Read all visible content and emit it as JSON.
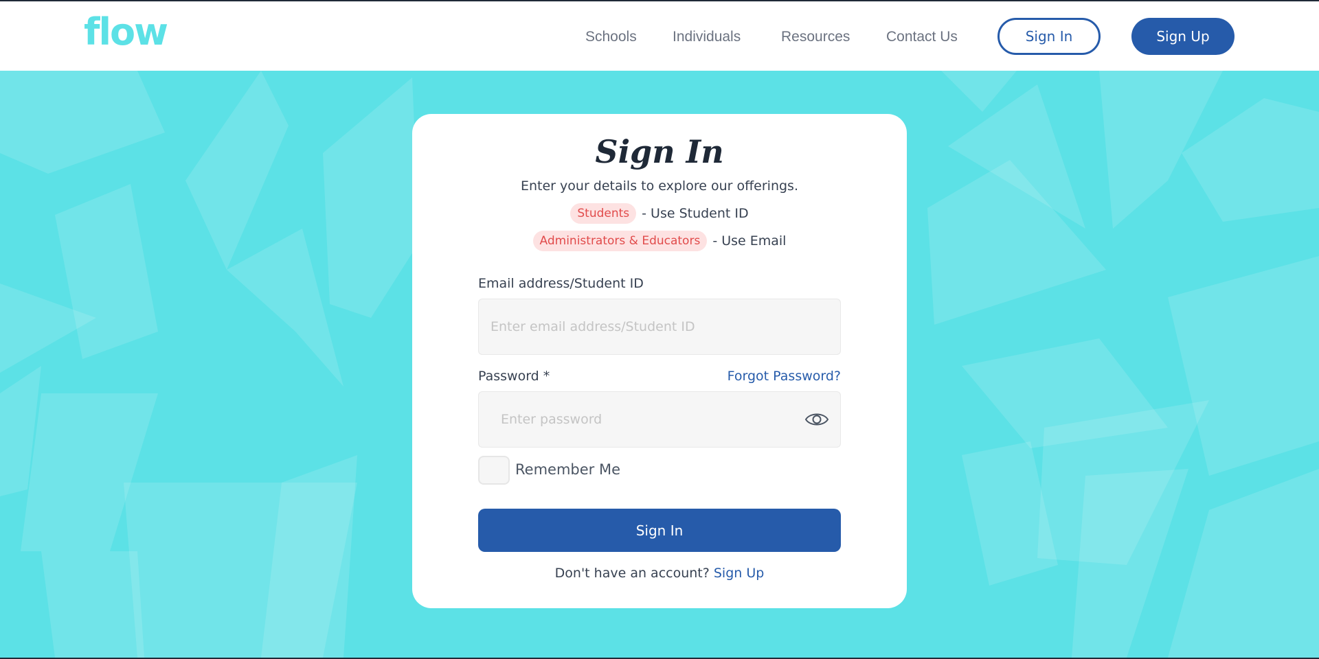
{
  "brand": {
    "logo_text": "flow",
    "logo_color": "#5ce1e6",
    "primary_color": "#265baa"
  },
  "nav": {
    "links": [
      "Schools",
      "Individuals",
      "Resources",
      "Contact Us"
    ],
    "sign_in_label": "Sign In",
    "sign_up_label": "Sign Up"
  },
  "form": {
    "title": "Sign In",
    "subtitle": "Enter your details to explore our offerings.",
    "roles": [
      {
        "badge": "Students",
        "hint": "- Use Student ID"
      },
      {
        "badge": "Administrators & Educators",
        "hint": "- Use Email"
      }
    ],
    "email": {
      "label": "Email address/Student ID",
      "placeholder": "Enter email address/Student ID",
      "value": ""
    },
    "password": {
      "label": "Password *",
      "placeholder": "Enter password",
      "value": "",
      "toggle_icon": "eye-icon"
    },
    "forgot_label": "Forgot Password?",
    "remember_label": "Remember Me",
    "remember_checked": false,
    "submit_label": "Sign In",
    "footer_text": "Don't have an account?",
    "footer_link": "Sign Up"
  }
}
